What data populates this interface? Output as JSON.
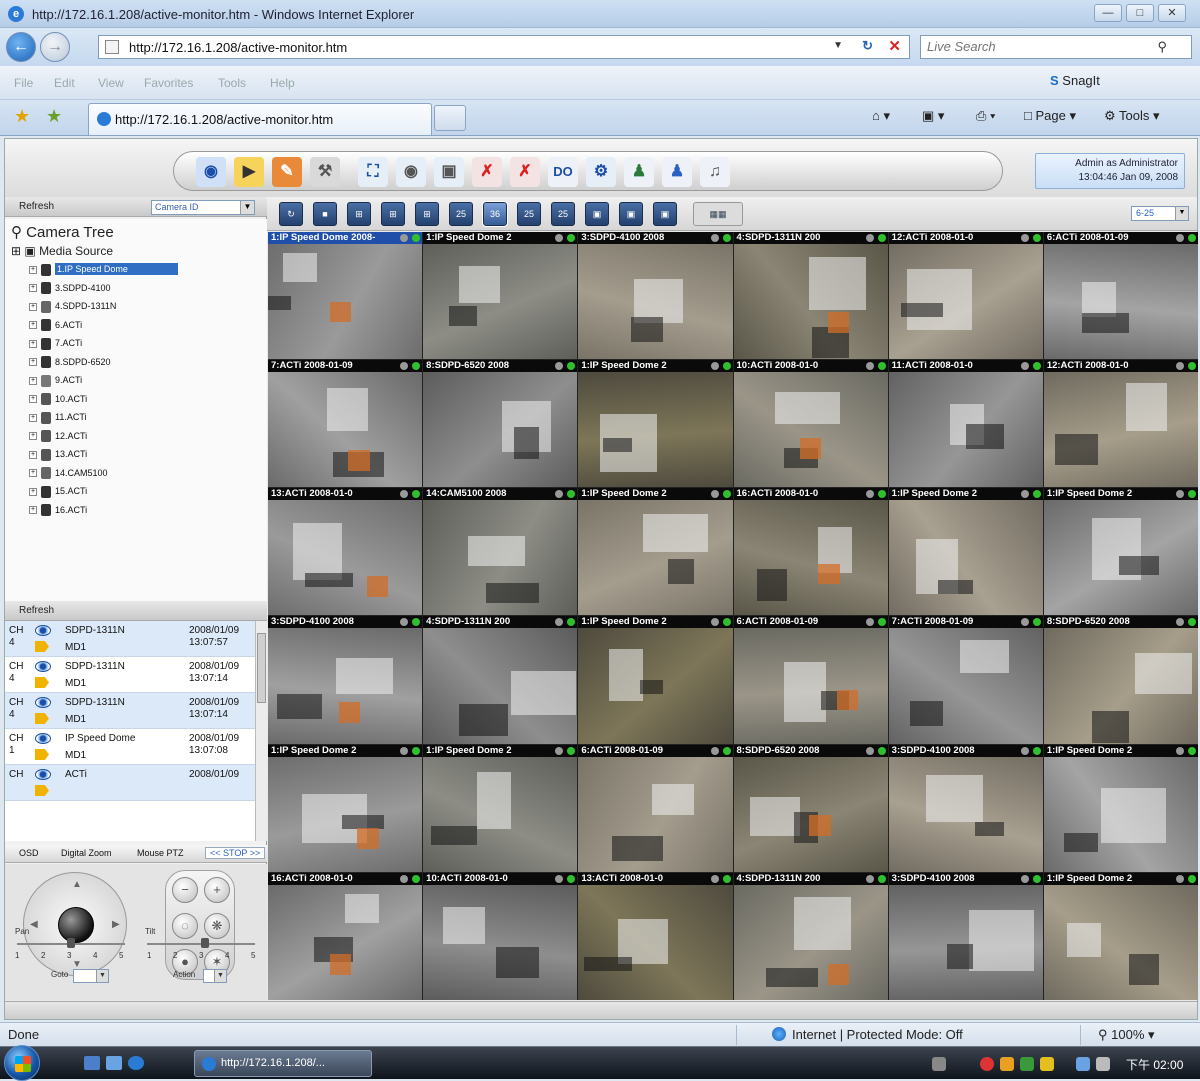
{
  "browser": {
    "window_title": "http://172.16.1.208/active-monitor.htm - Windows Internet Explorer",
    "address": "http://172.16.1.208/active-monitor.htm",
    "search_placeholder": "Live Search",
    "menu": [
      "File",
      "Edit",
      "View",
      "Favorites",
      "Tools",
      "Help"
    ],
    "snagit_label": "SnagIt",
    "tab_title": "http://172.16.1.208/active-monitor.htm",
    "command_bar": [
      "Page",
      "Tools"
    ]
  },
  "app": {
    "admin_line1": "Admin as Administrator",
    "admin_line2": "13:04:46 Jan 09, 2008",
    "tree_refresh_label": "Refresh",
    "camera_select_value": "Camera ID",
    "tree_title": "Camera Tree",
    "media_source_label": "Media Source",
    "cameras": [
      "1.IP Speed Dome",
      "3.SDPD-4100",
      "4.SDPD-1311N",
      "6.ACTi",
      "7.ACTi",
      "8.SDPD-6520",
      "9.ACTi",
      "10.ACTi",
      "11.ACTi",
      "12.ACTi",
      "13.ACTi",
      "14.CAM5100",
      "15.ACTi",
      "16.ACTi"
    ],
    "events_refresh_label": "Refresh",
    "events": [
      {
        "ch_label": "CH",
        "ch_num": "4",
        "name": "SDPD-1311N",
        "type": "MD1",
        "date": "2008/01/09",
        "time": "13:07:57"
      },
      {
        "ch_label": "CH",
        "ch_num": "4",
        "name": "SDPD-1311N",
        "type": "MD1",
        "date": "2008/01/09",
        "time": "13:07:14"
      },
      {
        "ch_label": "CH",
        "ch_num": "4",
        "name": "SDPD-1311N",
        "type": "MD1",
        "date": "2008/01/09",
        "time": "13:07:14"
      },
      {
        "ch_label": "CH",
        "ch_num": "1",
        "name": "IP Speed Dome",
        "type": "MD1",
        "date": "2008/01/09",
        "time": "13:07:08"
      },
      {
        "ch_label": "CH",
        "ch_num": "",
        "name": "ACTi",
        "type": "",
        "date": "2008/01/09",
        "time": ""
      }
    ],
    "ptz_tabs": [
      "OSD",
      "Digital Zoom",
      "Mouse PTZ",
      "<< STOP >>"
    ],
    "pan_label": "Pan",
    "tilt_label": "Tilt",
    "scale_numbers": [
      "1",
      "2",
      "3",
      "4",
      "5"
    ],
    "goto_label": "Goto",
    "action_label": "Action",
    "page_select_value": "6-25",
    "layout_buttons": [
      "25",
      "36",
      "25",
      "25"
    ],
    "tiles": [
      "1:IP Speed Dome   2008-",
      "1:IP Speed Dome   2",
      "3:SDPD-4100   2008",
      "4:SDPD-1311N   200",
      "12:ACTi   2008-01-0",
      "6:ACTi   2008-01-09",
      "7:ACTi   2008-01-09",
      "8:SDPD-6520   2008",
      "1:IP Speed Dome   2",
      "10:ACTi   2008-01-0",
      "11:ACTi   2008-01-0",
      "12:ACTi   2008-01-0",
      "13:ACTi   2008-01-0",
      "14:CAM5100   2008",
      "1:IP Speed Dome   2",
      "16:ACTi   2008-01-0",
      "1:IP Speed Dome   2",
      "1:IP Speed Dome   2",
      "3:SDPD-4100   2008",
      "4:SDPD-1311N   200",
      "1:IP Speed Dome   2",
      "6:ACTi   2008-01-09",
      "7:ACTi   2008-01-09",
      "8:SDPD-6520   2008",
      "1:IP Speed Dome   2",
      "1:IP Speed Dome   2",
      "6:ACTi   2008-01-09",
      "8:SDPD-6520   2008",
      "3:SDPD-4100   2008",
      "1:IP Speed Dome   2",
      "16:ACTi   2008-01-0",
      "10:ACTi   2008-01-0",
      "13:ACTi   2008-01-0",
      "4:SDPD-1311N   200",
      "3:SDPD-4100   2008",
      "1:IP Speed Dome   2"
    ]
  },
  "status": {
    "done": "Done",
    "zone": "Internet | Protected Mode: Off",
    "zoom": "100%"
  },
  "taskbar": {
    "item": "http://172.16.1.208/...",
    "clock": "下午 02:00"
  }
}
